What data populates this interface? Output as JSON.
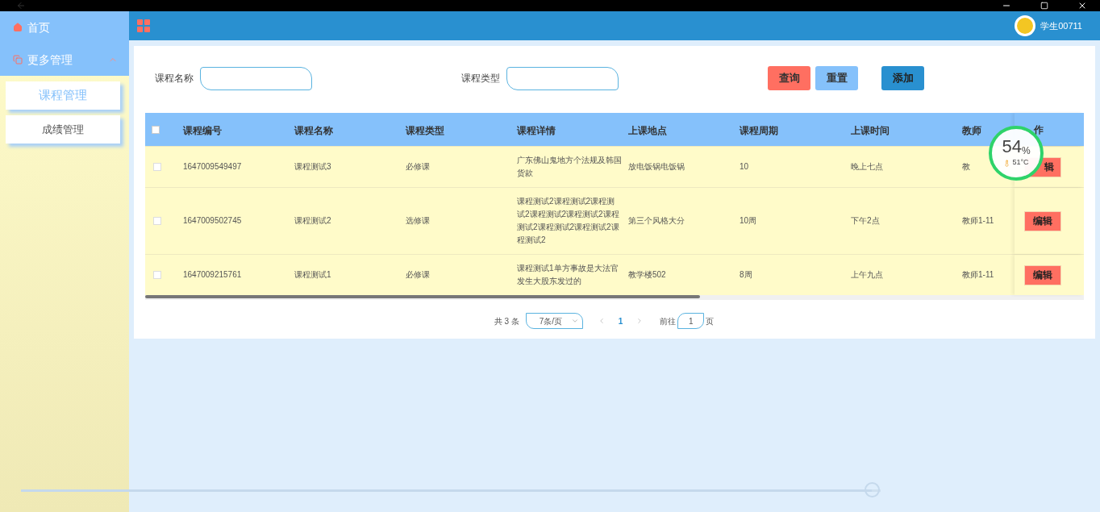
{
  "sidebar": {
    "items": [
      {
        "label": "首页",
        "kind": "link"
      },
      {
        "label": "更多管理",
        "kind": "group",
        "expanded": true,
        "children": [
          {
            "label": "课程管理",
            "selected": true
          },
          {
            "label": "成绩管理",
            "selected": false
          }
        ]
      }
    ]
  },
  "header": {
    "user": "学生00711"
  },
  "search": {
    "fields": [
      {
        "label": "课程名称"
      },
      {
        "label": "课程类型"
      }
    ],
    "buttons": [
      {
        "label": "查询",
        "kind": "danger"
      },
      {
        "label": "重置",
        "kind": "light"
      },
      {
        "label": "添加",
        "kind": "primary"
      }
    ]
  },
  "table": {
    "columns": [
      "课程编号",
      "课程名称",
      "课程类型",
      "课程详情",
      "上课地点",
      "课程周期",
      "上课时间",
      "教师",
      "作"
    ],
    "select_all": {
      "checked": false
    },
    "rows": [
      {
        "checked": false,
        "cells": [
          "1647009549497",
          "课程测试3",
          "必修课",
          "广东佛山鬼地方个法规及韩国货款",
          "放电饭锅电饭锅",
          "10",
          "晚上七点",
          "教"
        ],
        "action": "辑",
        "action_clipped": true
      },
      {
        "checked": false,
        "cells": [
          "1647009502745",
          "课程测试2",
          "选修课",
          "课程测试2课程测试2课程测试2课程测试2课程测试2课程测试2课程测试2课程测试2课程测试2",
          "第三个风格大分",
          "10周",
          "下午2点",
          "教师1-11"
        ],
        "action": "编辑"
      },
      {
        "checked": false,
        "cells": [
          "1647009215761",
          "课程测试1",
          "必修课",
          "课程测试1单方事故是大法官发生大股东发过的",
          "教学楼502",
          "8周",
          "上午九点",
          "教师1-11"
        ],
        "action": "编辑"
      }
    ]
  },
  "pagination": {
    "total": "共 3 条",
    "page_size": "7条/页",
    "pages": [
      {
        "label": "1",
        "selected": true
      }
    ],
    "goto_label": "前往",
    "goto_value": "1",
    "goto_suffix": "页"
  },
  "monitor_widget": {
    "percent": "54",
    "unit": "%",
    "temperature": "51°C"
  },
  "video_seek_bar": {
    "level": 0.99
  }
}
